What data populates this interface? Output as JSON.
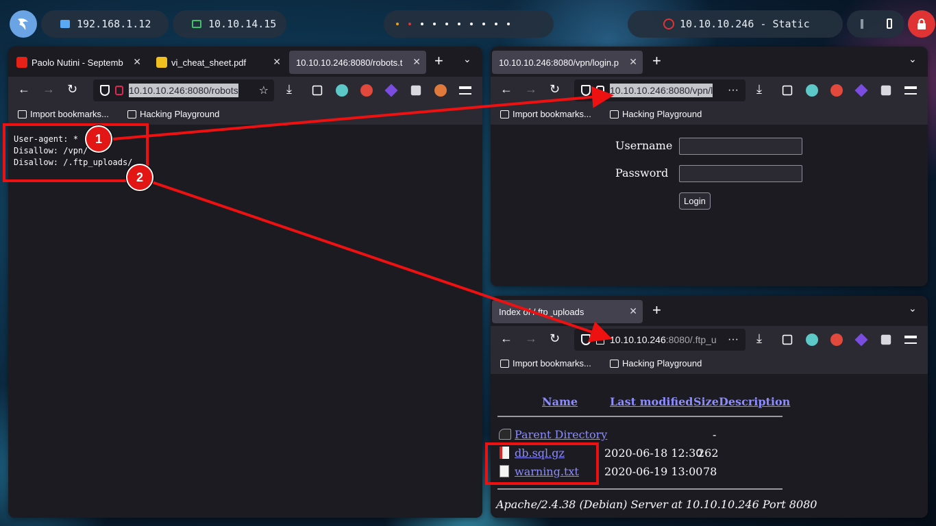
{
  "topbar": {
    "ip_local": "192.168.1.12",
    "ip_vpn": "10.10.14.15",
    "target": "10.10.10.246 - Static",
    "logo_icon": "kali-dragon-icon",
    "dot_colors": [
      "#e8a317",
      "#e03434",
      "#ffffff",
      "#ffffff",
      "#ffffff",
      "#ffffff",
      "#ffffff",
      "#ffffff",
      "#ffffff",
      "#ffffff"
    ]
  },
  "bookmarks": {
    "import": "Import bookmarks...",
    "folder": "Hacking Playground"
  },
  "win_left": {
    "tabs": [
      {
        "label": "Paolo Nutini - Septemb",
        "icon": "youtube-icon"
      },
      {
        "label": "vi_cheat_sheet.pdf",
        "icon": "pdf-icon"
      },
      {
        "label": "10.10.10.246:8080/robots.t",
        "icon": ""
      }
    ],
    "url": "10.10.10.246:8080/robots",
    "robots_lines": [
      "User-agent: *",
      "Disallow: /vpn/",
      "Disallow: /.ftp_uploads/"
    ]
  },
  "win_login": {
    "tab": "10.10.10.246:8080/vpn/login.p",
    "url": "10.10.10.246:8080/vpn/l",
    "username_label": "Username",
    "password_label": "Password",
    "login_button": "Login"
  },
  "win_index": {
    "tab": "Index of / ftp_uploads",
    "url_host": "10.10.10.246",
    "url_rest": ":8080/.ftp_u",
    "headers": {
      "name": "Name",
      "modified": "Last modified",
      "size": "Size",
      "desc": "Description"
    },
    "rows": [
      {
        "name": "Parent Directory",
        "modified": "",
        "size": "-"
      },
      {
        "name": "db.sql.gz",
        "modified": "2020-06-18 12:30",
        "size": "262"
      },
      {
        "name": "warning.txt",
        "modified": "2020-06-19 13:00",
        "size": "78"
      }
    ],
    "footer": "Apache/2.4.38 (Debian) Server at 10.10.10.246 Port 8080"
  },
  "annotations": {
    "badge1": "1",
    "badge2": "2",
    "accent": "#ee1111"
  }
}
